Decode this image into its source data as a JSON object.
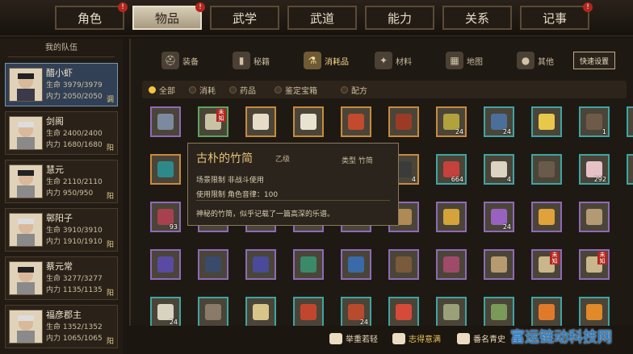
{
  "tabs": [
    {
      "label": "角色",
      "badge": "!"
    },
    {
      "label": "物品",
      "badge": "!",
      "active": true
    },
    {
      "label": "武学",
      "badge": ""
    },
    {
      "label": "武道",
      "badge": ""
    },
    {
      "label": "能力",
      "badge": ""
    },
    {
      "label": "关系",
      "badge": ""
    },
    {
      "label": "记事",
      "badge": "!"
    }
  ],
  "left": {
    "title": "我的队伍",
    "characters": [
      {
        "name": "醋小虾",
        "hp": "生命 3979/3979",
        "mp": "内力 2050/2050",
        "tag": "调"
      },
      {
        "name": "剑阁",
        "hp": "生命 2400/2400",
        "mp": "内力 1680/1680",
        "tag": "阳"
      },
      {
        "name": "慧元",
        "hp": "生命 2110/2110",
        "mp": "内力 950/950",
        "tag": "阳"
      },
      {
        "name": "鄣阳子",
        "hp": "生命 3910/3910",
        "mp": "内力 1910/1910",
        "tag": "阳"
      },
      {
        "name": "蔡元常",
        "hp": "生命 3277/3277",
        "mp": "内力 1135/1135",
        "tag": "阳"
      },
      {
        "name": "福彦郡主",
        "hp": "生命 1352/1352",
        "mp": "内力 1065/1065",
        "tag": "阳"
      }
    ]
  },
  "categories": [
    {
      "label": "装备",
      "icon": "helmet-icon"
    },
    {
      "label": "秘籍",
      "icon": "book-icon"
    },
    {
      "label": "消耗品",
      "icon": "potion-icon",
      "badge": "!"
    },
    {
      "label": "材料",
      "icon": "materials-icon"
    },
    {
      "label": "地图",
      "icon": "map-icon"
    },
    {
      "label": "其他",
      "icon": "orb-icon"
    }
  ],
  "quick_settings": "快速设置",
  "filters": [
    {
      "label": "全部",
      "on": true
    },
    {
      "label": "消耗",
      "on": false
    },
    {
      "label": "药品",
      "on": false
    },
    {
      "label": "鉴定宝箱",
      "on": false
    },
    {
      "label": "配方",
      "on": false
    }
  ],
  "rows": [
    [
      {
        "c": "purple",
        "i": "#7c8aa0",
        "n": ""
      },
      {
        "c": "green",
        "i": "#c9c3a6",
        "n": "",
        "nb": "未知"
      },
      {
        "c": "orange",
        "i": "#e7dcc7",
        "n": ""
      },
      {
        "c": "orange",
        "i": "#e8e2d0",
        "n": ""
      },
      {
        "c": "orange",
        "i": "#c24a2d",
        "n": ""
      },
      {
        "c": "orange",
        "i": "#9b3b26",
        "n": ""
      },
      {
        "c": "orange",
        "i": "#b2a23e",
        "n": "24"
      },
      {
        "c": "cyan",
        "i": "#4a6f9a",
        "n": "24"
      },
      {
        "c": "cyan",
        "i": "#e8c84a",
        "n": ""
      },
      {
        "c": "cyan",
        "i": "#6f5a4a",
        "n": "1"
      },
      {
        "c": "cyan",
        "i": "#7c5a8a",
        "n": ""
      }
    ],
    [
      {
        "c": "orange",
        "i": "#2e8a8a",
        "n": ""
      },
      {
        "c": "orange",
        "i": "#3b3b3b",
        "n": ""
      },
      {
        "c": "orange",
        "i": "#3b3b3b",
        "n": ""
      },
      {
        "c": "orange",
        "i": "#3b3b3b",
        "n": ""
      },
      {
        "c": "orange",
        "i": "#3b3b3b",
        "n": ""
      },
      {
        "c": "orange",
        "i": "#3b3b3b",
        "n": "4"
      },
      {
        "c": "cyan",
        "i": "#c5413b",
        "n": "664"
      },
      {
        "c": "cyan",
        "i": "#dcd4c2",
        "n": "4"
      },
      {
        "c": "cyan",
        "i": "#6a5a4a",
        "n": ""
      },
      {
        "c": "cyan",
        "i": "#e6c2c8",
        "n": "292"
      },
      {
        "c": "cyan",
        "i": "#3c62b8",
        "n": "24"
      }
    ],
    [
      {
        "c": "purple",
        "i": "#a8414f",
        "n": "93"
      },
      {
        "c": "purple",
        "i": "#3b3b3b",
        "n": ""
      },
      {
        "c": "purple",
        "i": "#3b3b3b",
        "n": ""
      },
      {
        "c": "purple",
        "i": "#3b3b3b",
        "n": ""
      },
      {
        "c": "purple",
        "i": "#3b3b3b",
        "n": ""
      },
      {
        "c": "purple",
        "i": "#b08a55",
        "n": ""
      },
      {
        "c": "purple",
        "i": "#d4a33a",
        "n": ""
      },
      {
        "c": "purple",
        "i": "#9a62c0",
        "n": "24"
      },
      {
        "c": "purple",
        "i": "#e0a23a",
        "n": ""
      },
      {
        "c": "purple",
        "i": "#b49a74",
        "n": ""
      }
    ],
    [
      {
        "c": "purple",
        "i": "#5a4aa3",
        "n": ""
      },
      {
        "c": "purple",
        "i": "#3a4a6a",
        "n": ""
      },
      {
        "c": "purple",
        "i": "#4a4a9a",
        "n": ""
      },
      {
        "c": "purple",
        "i": "#3a8a6a",
        "n": ""
      },
      {
        "c": "purple",
        "i": "#3a6aa8",
        "n": ""
      },
      {
        "c": "purple",
        "i": "#7a5a3a",
        "n": ""
      },
      {
        "c": "purple",
        "i": "#a04a6a",
        "n": ""
      },
      {
        "c": "purple",
        "i": "#b89a70",
        "n": ""
      },
      {
        "c": "purple",
        "i": "#c9b68a",
        "n": "",
        "nb": "未知"
      },
      {
        "c": "purple",
        "i": "#c9b68a",
        "n": "",
        "nb": "未知"
      }
    ],
    [
      {
        "c": "cyan",
        "i": "#d9d4c0",
        "n": "24"
      },
      {
        "c": "cyan",
        "i": "#8a7a6a",
        "n": ""
      },
      {
        "c": "cyan",
        "i": "#d9c48a",
        "n": ""
      },
      {
        "c": "cyan",
        "i": "#c2462d",
        "n": ""
      },
      {
        "c": "cyan",
        "i": "#b84a2d",
        "n": "24"
      },
      {
        "c": "cyan",
        "i": "#d64a3a",
        "n": ""
      },
      {
        "c": "cyan",
        "i": "#9aa07a",
        "n": ""
      },
      {
        "c": "cyan",
        "i": "#7a9a5a",
        "n": ""
      },
      {
        "c": "cyan",
        "i": "#e07a2a",
        "n": ""
      },
      {
        "c": "cyan",
        "i": "#e08a2a",
        "n": ""
      }
    ]
  ],
  "tooltip": {
    "title": "古朴的竹简",
    "grade": "乙级",
    "type": "类型  竹简",
    "scene": "场景限制    非战斗使用",
    "use": "使用限制    角色音律：100",
    "desc": "神秘的竹简，似乎记载了一篇高深的乐谱。"
  },
  "bottom": [
    {
      "label": "举重若轻",
      "color": "#e7d9b8",
      "icon": "weight-icon"
    },
    {
      "label": "志得意满",
      "color": "#e2c25a",
      "icon": "smile-icon"
    },
    {
      "label": "番名青史",
      "color": "#e7d9b8",
      "icon": "scroll-icon"
    }
  ],
  "watermark": "富运链动科技网"
}
